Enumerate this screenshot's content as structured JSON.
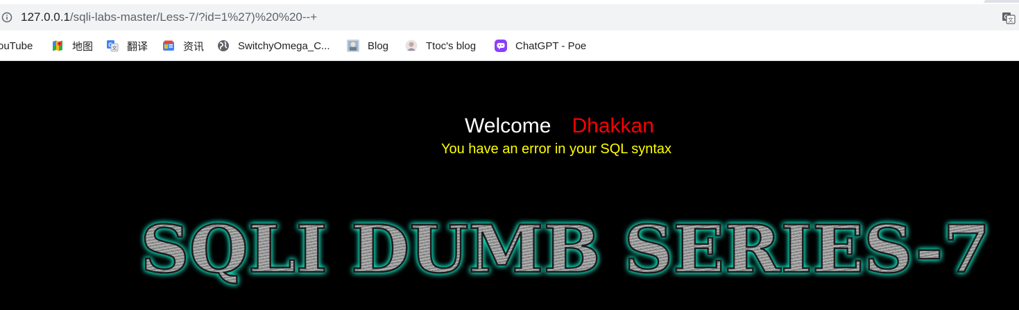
{
  "browser": {
    "url_host": "127.0.0.1",
    "url_path": "/sqli-labs-master/Less-7/?id=1%27)%20%20--+"
  },
  "bookmarks": [
    {
      "label": "ouTube",
      "icon": "youtube-icon"
    },
    {
      "label": "地图",
      "icon": "maps-icon"
    },
    {
      "label": "翻译",
      "icon": "translate-icon"
    },
    {
      "label": "资讯",
      "icon": "news-icon"
    },
    {
      "label": "SwitchyOmega_C...",
      "icon": "globe-icon"
    },
    {
      "label": "Blog",
      "icon": "blog-avatar-icon"
    },
    {
      "label": "Ttoc's blog",
      "icon": "avatar-icon"
    },
    {
      "label": "ChatGPT - Poe",
      "icon": "poe-icon"
    }
  ],
  "page": {
    "welcome_word": "Welcome",
    "welcome_name": "Dhakkan",
    "error_message": "You have an error in your SQL syntax",
    "banner_text": "SQLI DUMB SERIES-7"
  },
  "colors": {
    "page_background": "#000000",
    "welcome_color": "#ffffff",
    "name_color": "#ff0000",
    "error_color": "#ffff00",
    "banner_glow": "#19e6c4",
    "banner_metal": "#8c8c8c"
  }
}
